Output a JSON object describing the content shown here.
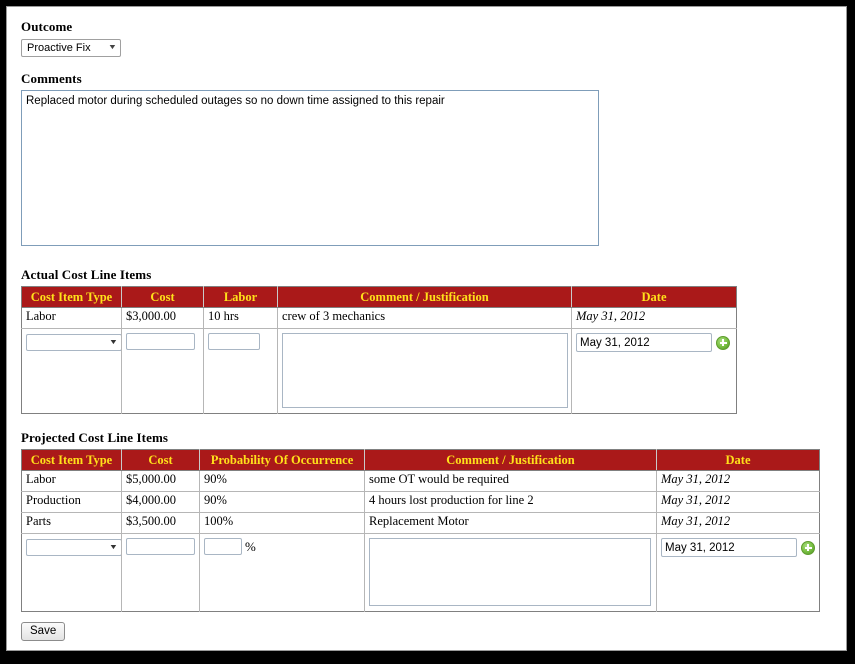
{
  "outcome": {
    "label": "Outcome",
    "selected": "Proactive Fix",
    "caret": "▼"
  },
  "comments": {
    "label": "Comments",
    "value": "Replaced motor during scheduled outages so no down time assigned to this repair"
  },
  "actual_cost": {
    "label": "Actual Cost Line Items",
    "columns": [
      "Cost Item Type",
      "Cost",
      "Labor",
      "Comment / Justification",
      "Date"
    ],
    "rows": [
      {
        "cost_item_type": "Labor",
        "cost": "$3,000.00",
        "labor": "10 hrs",
        "comment": "crew of 3 mechanics",
        "date": "May 31, 2012"
      }
    ],
    "entry_row": {
      "cost_item_type": "",
      "cost": "",
      "labor": "",
      "comment": "",
      "date": "May 31, 2012",
      "caret": "▼"
    }
  },
  "projected_cost": {
    "label": "Projected Cost Line Items",
    "columns": [
      "Cost Item Type",
      "Cost",
      "Probability Of Occurrence",
      "Comment / Justification",
      "Date"
    ],
    "rows": [
      {
        "cost_item_type": "Labor",
        "cost": "$5,000.00",
        "probability": "90%",
        "comment": "some OT would be required",
        "date": "May 31, 2012"
      },
      {
        "cost_item_type": "Production",
        "cost": "$4,000.00",
        "probability": "90%",
        "comment": "4 hours lost production for line 2",
        "date": "May 31, 2012"
      },
      {
        "cost_item_type": "Parts",
        "cost": "$3,500.00",
        "probability": "100%",
        "comment": "Replacement Motor",
        "date": "May 31, 2012"
      }
    ],
    "entry_row": {
      "cost_item_type": "",
      "cost": "",
      "probability": "",
      "percent_sign": "%",
      "comment": "",
      "date": "May 31, 2012",
      "caret": "▼"
    }
  },
  "save": {
    "label": "Save"
  },
  "colors": {
    "header_background": "#AA1919",
    "header_text": "#FFE11A",
    "readonly_date_text": "#C8C8C8",
    "input_border": "#A9B6C4",
    "textarea_border": "#7F9DB9",
    "page_border": "#000000",
    "calendar_icon": "#79C043"
  }
}
